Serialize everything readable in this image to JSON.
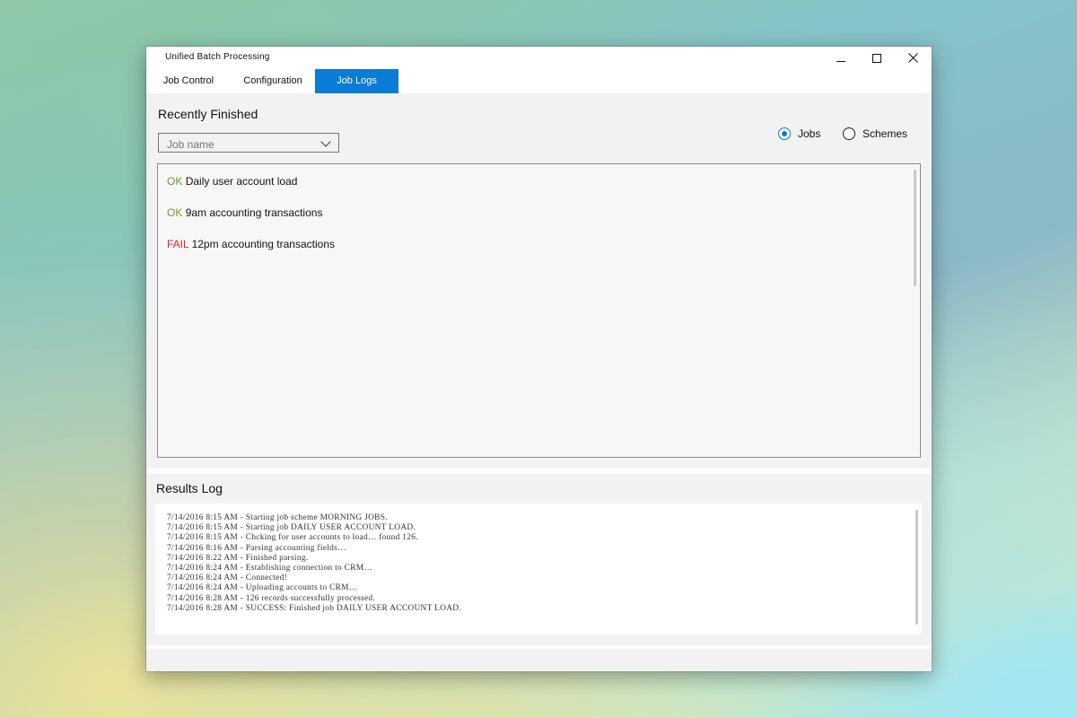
{
  "window": {
    "title": "Unified Batch Processing"
  },
  "tabs": [
    {
      "label": "Job Control",
      "active": false
    },
    {
      "label": "Configuration",
      "active": false
    },
    {
      "label": "Job Logs",
      "active": true
    }
  ],
  "recent": {
    "title": "Recently Finished",
    "dropdown_placeholder": "Job name",
    "radio_jobs_label": "Jobs",
    "radio_schemes_label": "Schemes",
    "selected_filter": "Jobs",
    "jobs": [
      {
        "status": "OK",
        "name": "Daily user account load"
      },
      {
        "status": "OK",
        "name": "9am accounting transactions"
      },
      {
        "status": "FAIL",
        "name": "12pm accounting transactions"
      }
    ]
  },
  "results": {
    "title": "Results Log",
    "lines": [
      "7/14/2016 8:15 AM - Starting job scheme MORNING JOBS.",
      "7/14/2016 8:15 AM - Starting job DAILY USER ACCOUNT LOAD.",
      "7/14/2016 8:15 AM - Chcking for user accounts to load… found 126.",
      "7/14/2016 8:16 AM - Parsing accounting fields…",
      "7/14/2016 8:22 AM - Finished parsing.",
      "7/14/2016 8:24 AM - Establishing connection to CRM…",
      "7/14/2016 8:24 AM - Connected!",
      "7/14/2016 8:24 AM - Uploading accounts to CRM…",
      "7/14/2016 8:28 AM - 126 records successfully processed.",
      "7/14/2016 8:28 AM - SUCCESS: Finished job DAILY USER ACCOUNT LOAD."
    ]
  },
  "colors": {
    "accent": "#0a7bd6",
    "ok": "#5fa52a",
    "fail": "#d7262f"
  },
  "icons": {
    "minimize": "minimize-icon",
    "maximize": "maximize-icon",
    "close": "close-icon",
    "dropdown": "chevron-down-icon"
  }
}
